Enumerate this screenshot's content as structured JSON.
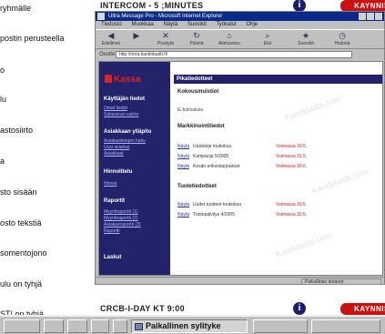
{
  "background": {
    "left_items": [
      "ryhmälle",
      "postin perusteella",
      "o",
      "lu",
      "astosiirto",
      "a",
      "sto sisään",
      "osto tekstiä",
      "somentojono",
      "ulu on tyhjä",
      "ST! on tyhjä"
    ],
    "top_row": {
      "code": "INTERCOM -  5 ;MINUTES",
      "info": "i",
      "badge": "KAYNNISTA"
    },
    "bottom_row": {
      "code": "CRCB-I-DAY KT 9:00",
      "info": "i",
      "badge": "KAYNNISTA"
    }
  },
  "window": {
    "title": "Ultra Message Pro - Microsoft Internet Explorer",
    "menu": [
      "Tiedosto",
      "Muokkaa",
      "Näytä",
      "Suosikit",
      "Työkalut",
      "Ohje"
    ],
    "toolbar": [
      {
        "label": "Edellinen",
        "icon": "back-arrow-icon",
        "glyph": "◀"
      },
      {
        "label": "",
        "icon": "forward-arrow-icon",
        "glyph": "▶"
      },
      {
        "label": "Pysäytä",
        "icon": "stop-icon",
        "glyph": "✕"
      },
      {
        "label": "Päivitä",
        "icon": "refresh-icon",
        "glyph": "↻"
      },
      {
        "label": "Aloitussivu",
        "icon": "home-icon",
        "glyph": "⌂"
      },
      {
        "label": "Etsi",
        "icon": "search-icon",
        "glyph": "⌕"
      },
      {
        "label": "Suosikit",
        "icon": "favorites-icon",
        "glyph": "★"
      },
      {
        "label": "Historia",
        "icon": "history-icon",
        "glyph": "◷"
      }
    ],
    "address": {
      "label": "Osoite",
      "value": "http://intra.kandidaatti.fi/"
    },
    "status": {
      "left": "",
      "zone": "Paikallinen intranet"
    }
  },
  "page": {
    "logo": "Kassa",
    "sidebar": {
      "sections": [
        {
          "title": "Käyttäjän tiedot",
          "links": [
            "Omat tiedot",
            "Salasanan vaihto"
          ]
        },
        {
          "title": "Asiakkaan ylläpito",
          "links": [
            "Asiakastietojen haku",
            "Uusi asiakas",
            "Asiakkaat"
          ]
        },
        {
          "title": "Hinnoittelu",
          "links": [
            "Hinnat"
          ]
        },
        {
          "title": "Raportit",
          "links": [
            "Myyntiraportti (1)",
            "Myyntiraportti (2)",
            "Asiakasraportti (3)",
            "Raportti"
          ]
        },
        {
          "title": "Laskut",
          "links": []
        }
      ]
    },
    "main": {
      "title": "Pikatiedotteet",
      "sections": [
        {
          "title": "Kokousmuistiot",
          "text": "Ei kokouksia"
        },
        {
          "title": "Markkinointitiedot",
          "rows": [
            {
              "link": "Näytä",
              "name": "Uutiskirje toukokuu",
              "date": "Voimassa 30.5."
            },
            {
              "link": "Näytä",
              "name": "Kampanja 5/2005",
              "date": "Voimassa 31.5."
            },
            {
              "link": "Näytä",
              "name": "Kesän erikoistarjoukset",
              "date": "Voimassa 30.6."
            }
          ]
        },
        {
          "title": "Tuotetiedotteet",
          "rows": [
            {
              "link": "Näytä",
              "name": "Uudet tuotteet toukokuu",
              "date": "Voimassa 30.5."
            },
            {
              "link": "Näytä",
              "name": "Tuotepäivitys 4/2005",
              "date": "Voimassa 30.5."
            }
          ]
        }
      ]
    },
    "watermark": "Kandidaatti.com"
  },
  "taskbar": {
    "active": "Paikallinen sylityke"
  }
}
